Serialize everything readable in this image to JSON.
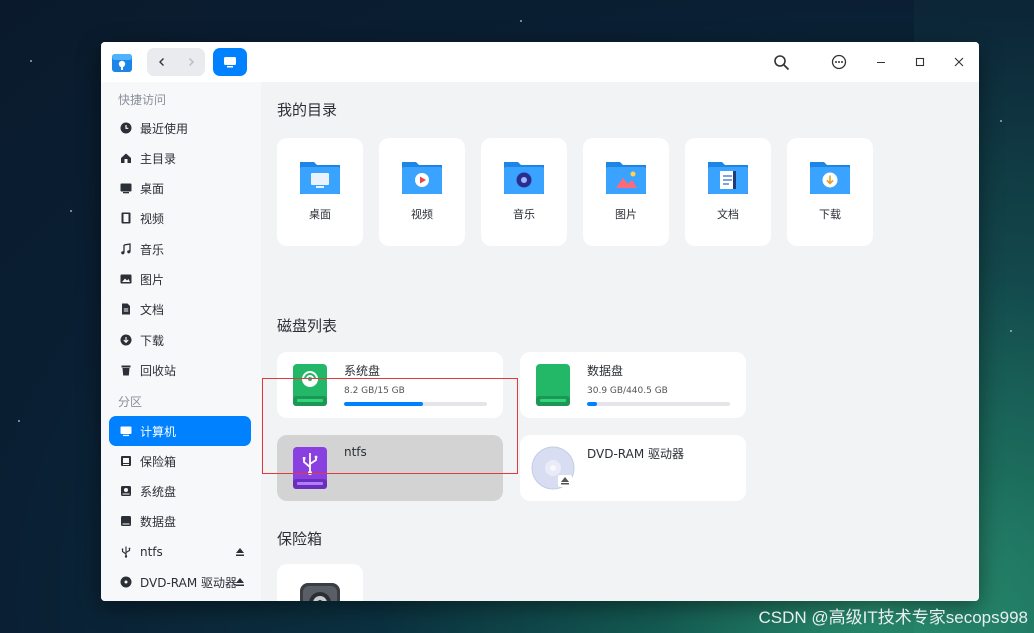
{
  "colors": {
    "accent": "#0081ff",
    "selection_outline": "#e0393e"
  },
  "titlebar": {
    "back_icon": "chevron-left-icon",
    "forward_icon": "chevron-right-icon",
    "view_icon": "computer-icon",
    "search_icon": "search-icon",
    "menu_icon": "more-icon",
    "minimize_icon": "minimize-icon",
    "maximize_icon": "maximize-icon",
    "close_icon": "close-icon"
  },
  "sidebar": {
    "quick_access_title": "快捷访问",
    "quick_items": [
      {
        "label": "最近使用",
        "icon": "clock-icon"
      },
      {
        "label": "主目录",
        "icon": "home-icon"
      },
      {
        "label": "桌面",
        "icon": "desktop-icon"
      },
      {
        "label": "视频",
        "icon": "video-icon"
      },
      {
        "label": "音乐",
        "icon": "music-icon"
      },
      {
        "label": "图片",
        "icon": "picture-icon"
      },
      {
        "label": "文档",
        "icon": "document-icon"
      },
      {
        "label": "下载",
        "icon": "download-icon"
      },
      {
        "label": "回收站",
        "icon": "trash-icon"
      }
    ],
    "partition_title": "分区",
    "partition_items": [
      {
        "label": "计算机",
        "icon": "computer-icon",
        "active": true
      },
      {
        "label": "保险箱",
        "icon": "vault-icon"
      },
      {
        "label": "系统盘",
        "icon": "disk-icon"
      },
      {
        "label": "数据盘",
        "icon": "disk-icon"
      },
      {
        "label": "ntfs",
        "icon": "usb-icon",
        "ejectable": true
      },
      {
        "label": "DVD-RAM 驱动器",
        "icon": "optical-drive-icon",
        "ejectable": true
      }
    ]
  },
  "main": {
    "my_dirs_title": "我的目录",
    "dirs": [
      {
        "label": "桌面",
        "icon": "desktop-folder-icon"
      },
      {
        "label": "视频",
        "icon": "video-folder-icon"
      },
      {
        "label": "音乐",
        "icon": "music-folder-icon"
      },
      {
        "label": "图片",
        "icon": "picture-folder-icon"
      },
      {
        "label": "文档",
        "icon": "document-folder-icon"
      },
      {
        "label": "下载",
        "icon": "download-folder-icon"
      }
    ],
    "disks_title": "磁盘列表",
    "disks": [
      {
        "name": "系统盘",
        "size": "8.2 GB/15 GB",
        "usage_fraction": 0.55,
        "icon": "system-disk-icon"
      },
      {
        "name": "数据盘",
        "size": "30.9 GB/440.5 GB",
        "usage_fraction": 0.07,
        "icon": "data-disk-icon"
      },
      {
        "name": "ntfs",
        "icon": "usb-drive-icon",
        "selected": true
      },
      {
        "name": "DVD-RAM 驱动器",
        "icon": "optical-disc-icon"
      }
    ],
    "vault_title": "保险箱",
    "vault_item_icon": "vault-safe-icon"
  },
  "watermark": "CSDN @高级IT技术专家secops998"
}
